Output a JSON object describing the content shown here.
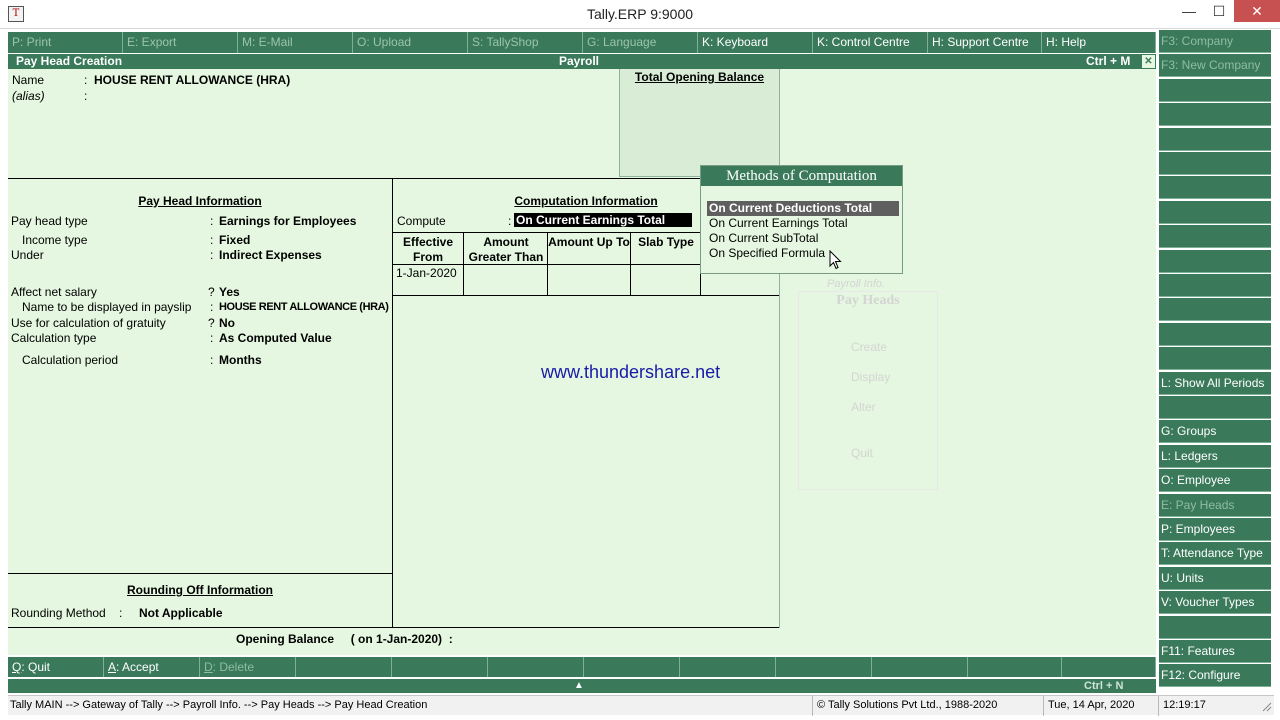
{
  "window": {
    "title": "Tally.ERP 9:9000",
    "min_glyph": "—",
    "max_glyph": "☐",
    "close_glyph": "✕",
    "app_icon_glyph": "T"
  },
  "top_buttons": [
    {
      "key": "P",
      "label": ": Print",
      "enabled": false
    },
    {
      "key": "E",
      "label": ": Export",
      "enabled": false
    },
    {
      "key": "M",
      "label": ": E-Mail",
      "enabled": false
    },
    {
      "key": "O",
      "label": ": Upload",
      "enabled": false
    },
    {
      "key": "S",
      "label": ": TallyShop",
      "enabled": false
    },
    {
      "key": "G",
      "label": ": Language",
      "enabled": false
    },
    {
      "key": "K",
      "label": ": Keyboard",
      "enabled": true
    },
    {
      "key": "K",
      "label": ": Control Centre",
      "enabled": true
    },
    {
      "key": "H",
      "label": ": Support Centre",
      "enabled": true
    },
    {
      "key": "H",
      "label": ": Help",
      "enabled": true
    }
  ],
  "right_buttons": [
    {
      "label": "F3: Company",
      "enabled": false
    },
    {
      "label": "F3: New Company",
      "enabled": false
    },
    {
      "label": "",
      "enabled": true
    },
    {
      "label": "",
      "enabled": true
    },
    {
      "label": "",
      "enabled": true
    },
    {
      "label": "",
      "enabled": true
    },
    {
      "label": "",
      "enabled": true
    },
    {
      "label": "",
      "enabled": true
    },
    {
      "label": "",
      "enabled": true
    },
    {
      "label": "",
      "enabled": true
    },
    {
      "label": "",
      "enabled": true
    },
    {
      "label": "",
      "enabled": true
    },
    {
      "label": "",
      "enabled": true
    },
    {
      "label": "",
      "enabled": true
    },
    {
      "label": "L: Show All Periods",
      "enabled": true
    },
    {
      "label": "",
      "enabled": true
    },
    {
      "label": "G: Groups",
      "enabled": true
    },
    {
      "label": "L: Ledgers",
      "enabled": true
    },
    {
      "label": "O: Employee Groups",
      "enabled": true
    },
    {
      "label": "E: Pay Heads",
      "enabled": false
    },
    {
      "label": "P: Employees",
      "enabled": true
    },
    {
      "label": "T: Attendance Type",
      "enabled": true
    },
    {
      "label": "U: Units",
      "enabled": true
    },
    {
      "label": "V: Voucher Types",
      "enabled": true
    },
    {
      "label": "",
      "enabled": true
    },
    {
      "label": "F11: Features",
      "enabled": true
    },
    {
      "label": "F12: Configure",
      "enabled": true
    }
  ],
  "header": {
    "left": "Pay Head  Creation",
    "center": "Payroll",
    "right": "Ctrl + M",
    "close_glyph": "✕"
  },
  "name_section": {
    "name_label": "Name",
    "name_value": "HOUSE RENT ALLOWANCE (HRA)",
    "alias_label": "(alias)",
    "separator": ":"
  },
  "total_opening_balance_label": "Total Opening Balance",
  "pay_head_info": {
    "title": "Pay Head Information",
    "rows": [
      {
        "label": "Pay head type",
        "sep": ":",
        "value": "Earnings for Employees"
      },
      {
        "label": "Income type",
        "sep": ":",
        "value": "Fixed"
      },
      {
        "label": "Under",
        "sep": ":",
        "value": "Indirect Expenses"
      },
      {
        "label": "Affect net salary",
        "sep": "?",
        "value": "Yes"
      },
      {
        "label": "Name to be displayed in payslip",
        "sep": ":",
        "value": "HOUSE RENT ALLOWANCE (HRA)"
      },
      {
        "label": "Use for calculation of gratuity",
        "sep": "?",
        "value": "No"
      },
      {
        "label": "Calculation type",
        "sep": ":",
        "value": "As Computed Value"
      },
      {
        "label": "Calculation period",
        "sep": ":",
        "value": "Months"
      }
    ]
  },
  "computation_info": {
    "title": "Computation Information",
    "compute_label": "Compute",
    "compute_sep": ":",
    "compute_value": "On Current Earnings Total",
    "columns": [
      "Effective From",
      "Amount Greater Than",
      "Amount Up To",
      "Slab Type"
    ],
    "first_date": "1-Jan-2020"
  },
  "watermark": "www.thundershare.net",
  "rounding": {
    "title": "Rounding Off Information",
    "label": "Rounding Method",
    "sep": ":",
    "value": "Not Applicable"
  },
  "opening_balance_line": "Opening Balance     ( on 1-Jan-2020)  :",
  "popup": {
    "title": "Methods of Computation",
    "items": [
      "On Current Deductions Total",
      "On Current Earnings Total",
      "On Current SubTotal",
      "On Specified Formula"
    ],
    "selected_index": 0
  },
  "ghost_menu": {
    "title": "Payroll Info.",
    "subtitle": "Pay Heads",
    "items": [
      "Create",
      "Display",
      "Alter",
      "Quit"
    ]
  },
  "bottom_buttons": [
    {
      "key": "Q",
      "label": ": Quit",
      "enabled": true
    },
    {
      "key": "A",
      "label": ": Accept",
      "enabled": true
    },
    {
      "key": "D",
      "label": ": Delete",
      "enabled": false
    }
  ],
  "ctrl_n_bar": {
    "arrow_glyph": "▲",
    "label": "Ctrl + N"
  },
  "status": {
    "breadcrumb": "Tally MAIN --> Gateway of Tally --> Payroll Info. --> Pay Heads --> Pay Head  Creation",
    "copyright": "© Tally Solutions Pvt Ltd., 1988-2020",
    "date": "Tue, 14 Apr, 2020",
    "time": "12:19:17"
  },
  "colors": {
    "accent_green": "#3a7a5a",
    "panel_bg": "#e5f7e0",
    "watermark_blue": "#1a1aa8"
  }
}
